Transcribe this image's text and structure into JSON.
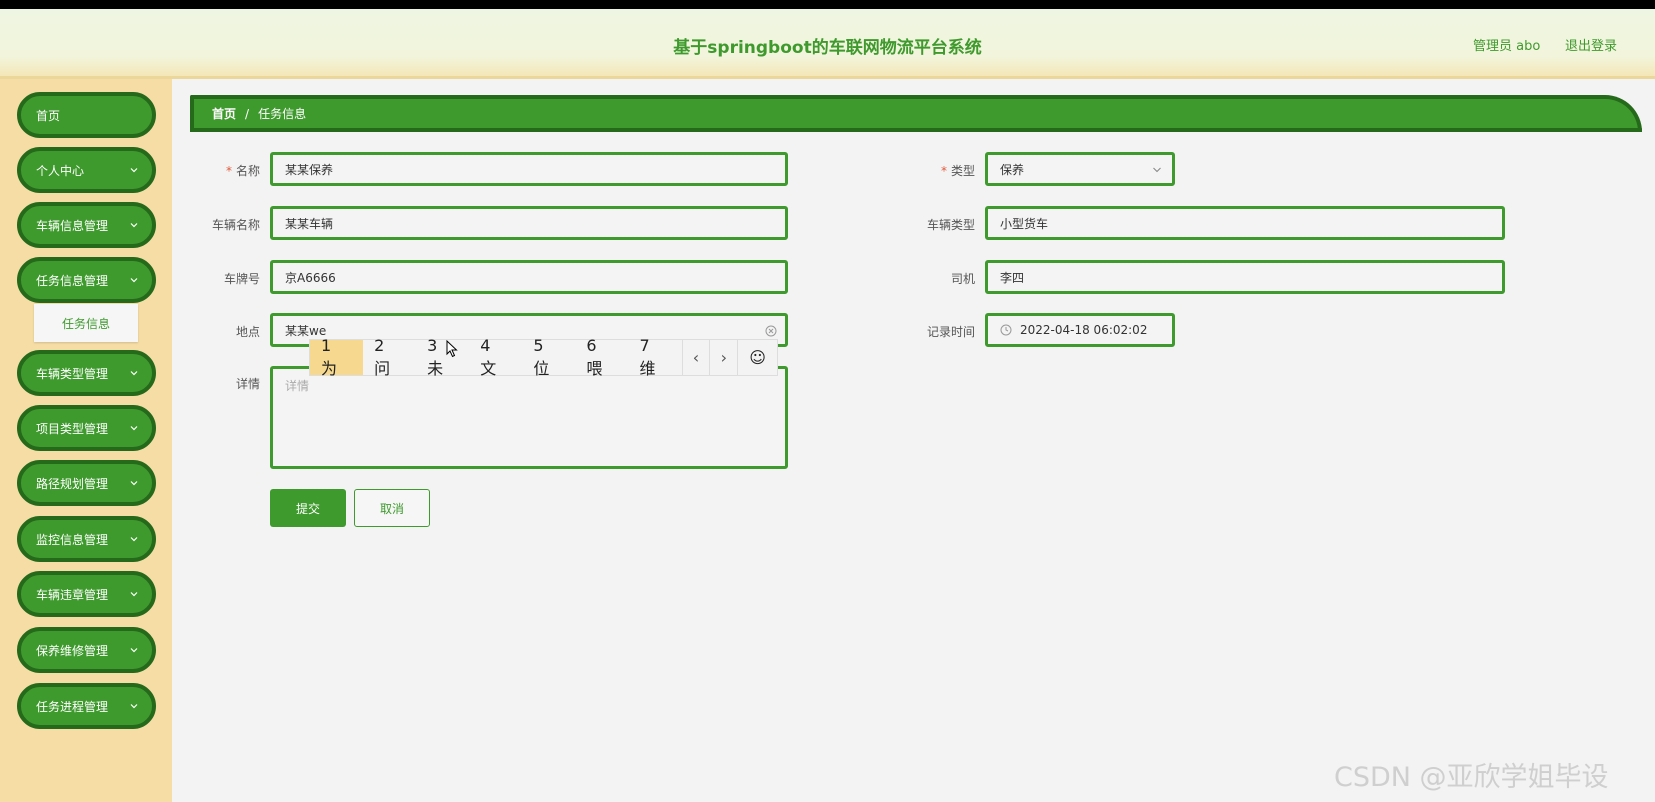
{
  "header": {
    "title": "基于springboot的车联网物流平台系统",
    "user": "管理员 abo",
    "logout": "退出登录"
  },
  "sidebar": {
    "items": [
      {
        "label": "首页",
        "has_arrow": false
      },
      {
        "label": "个人中心",
        "has_arrow": true
      },
      {
        "label": "车辆信息管理",
        "has_arrow": true
      },
      {
        "label": "任务信息管理",
        "has_arrow": true,
        "expanded": true
      },
      {
        "label": "车辆类型管理",
        "has_arrow": true
      },
      {
        "label": "项目类型管理",
        "has_arrow": true
      },
      {
        "label": "路径规划管理",
        "has_arrow": true
      },
      {
        "label": "监控信息管理",
        "has_arrow": true
      },
      {
        "label": "车辆违章管理",
        "has_arrow": true
      },
      {
        "label": "保养维修管理",
        "has_arrow": true
      },
      {
        "label": "任务进程管理",
        "has_arrow": true
      }
    ],
    "sub_item": "任务信息"
  },
  "breadcrumb": {
    "home": "首页",
    "separator": "/",
    "current": "任务信息"
  },
  "form": {
    "name_label": "名称",
    "name_value": "某某保养",
    "type_label": "类型",
    "type_value": "保养",
    "vehicle_name_label": "车辆名称",
    "vehicle_name_value": "某某车辆",
    "vehicle_type_label": "车辆类型",
    "vehicle_type_value": "小型货车",
    "plate_label": "车牌号",
    "plate_value": "京A6666",
    "driver_label": "司机",
    "driver_value": "李四",
    "location_label": "地点",
    "location_value": "某某we",
    "record_time_label": "记录时间",
    "record_time_value": "2022-04-18 06:02:02",
    "details_label": "详情",
    "details_placeholder": "详情",
    "required_mark": "*"
  },
  "ime": {
    "candidates": [
      "1 为",
      "2 问",
      "3 未",
      "4 文",
      "5 位",
      "6 喂",
      "7 维"
    ],
    "prev": "‹",
    "next": "›",
    "emoji": "☺"
  },
  "buttons": {
    "submit": "提交",
    "cancel": "取消"
  },
  "watermark": "CSDN @亚欣学姐毕设",
  "colors": {
    "primary": "#3f9a2e",
    "primary_dark": "#25691a",
    "sidebar_bg": "#f6dda5",
    "ime_active": "#f6d98e"
  }
}
